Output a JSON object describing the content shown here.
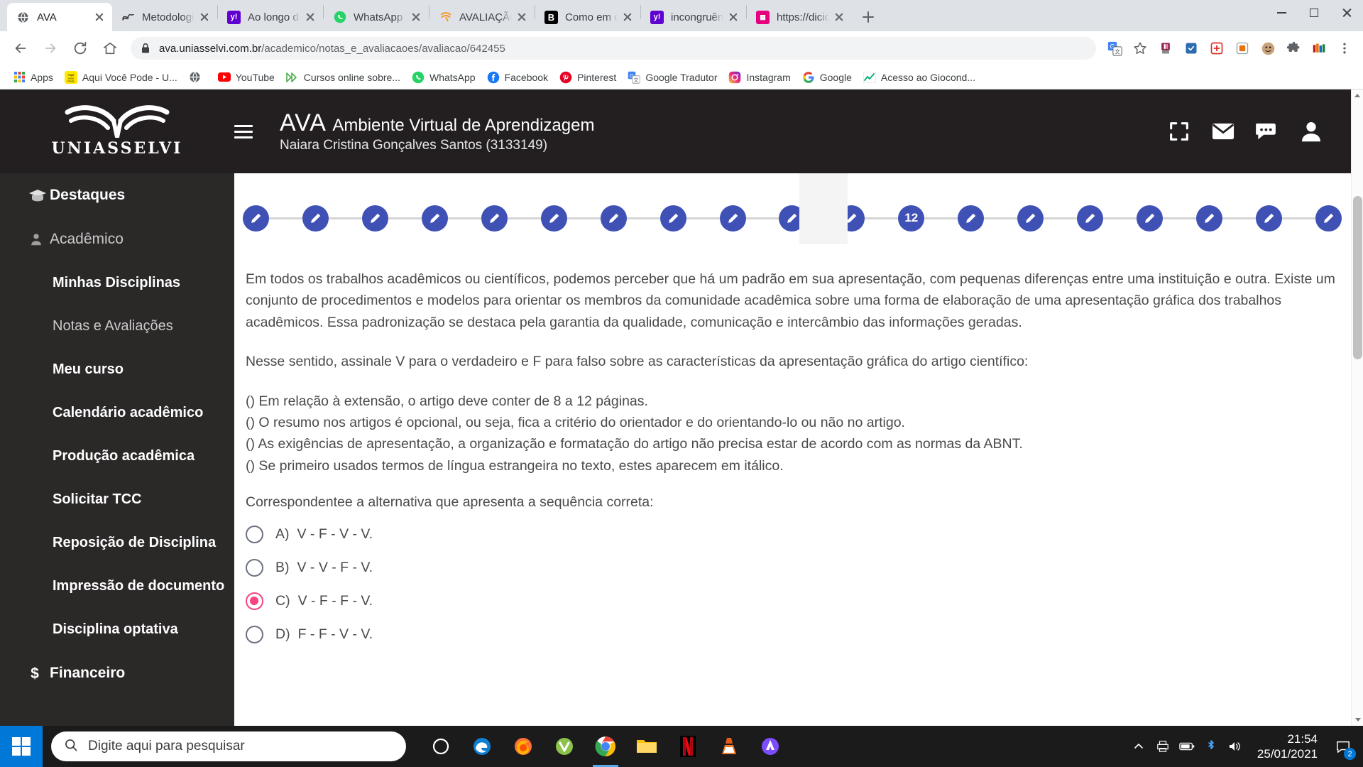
{
  "browser": {
    "tabs": [
      {
        "title": "AVA",
        "favicon": "globe-icon",
        "favicon_color": "#5f6368",
        "active": true
      },
      {
        "title": "Metodologia",
        "favicon": "wave-icon",
        "favicon_color": "#231f20",
        "active": false
      },
      {
        "title": "Ao longo do",
        "favicon": "yahoo-icon",
        "favicon_color": "#6001d2",
        "active": false
      },
      {
        "title": "WhatsApp",
        "favicon": "whatsapp-icon",
        "favicon_color": "#25d366",
        "active": false
      },
      {
        "title": "AVALIAÇÃO",
        "favicon": "uniasselvi-icon",
        "favicon_color": "#f7941d",
        "active": false
      },
      {
        "title": "Como em qu",
        "favicon": "brainly-icon",
        "favicon_color": "#000000",
        "active": false
      },
      {
        "title": "incongruênc",
        "favicon": "yahoo-icon",
        "favicon_color": "#6001d2",
        "active": false
      },
      {
        "title": "https://dicio",
        "favicon": "dicio-icon",
        "favicon_color": "#e6007e",
        "active": false
      }
    ],
    "newtab_label": "Nova guia",
    "window_controls": {
      "minimize": "minimize-button",
      "maximize": "maximize-button",
      "close": "close-button"
    },
    "nav": {
      "back": "Voltar",
      "forward": "Avançar",
      "reload": "Recarregar",
      "home": "Página inicial"
    },
    "omnibox": {
      "secure_icon": "lock-icon",
      "host": "ava.uniasselvi.com.br",
      "path": "/academico/notas_e_avaliacaoes/avaliacao/642455",
      "full_url": "ava.uniasselvi.com.br/academico/notas_e_avaliacaoes/avaliacao/642455"
    },
    "toolbar_extensions": [
      {
        "name": "translate-icon",
        "color": "#4285f4"
      },
      {
        "name": "bookmark-star-icon",
        "color": "#5f6368"
      },
      {
        "name": "extension-pink-icon",
        "color": "#8e2252"
      },
      {
        "name": "extension-blue-icon",
        "color": "#2b6cb0"
      },
      {
        "name": "extension-red-icon",
        "color": "#d93025"
      },
      {
        "name": "extension-orange-icon",
        "color": "#e8710a"
      },
      {
        "name": "extension-avatar-icon",
        "color": "#8d6e63"
      },
      {
        "name": "extensions-puzzle-icon",
        "color": "#5f6368"
      },
      {
        "name": "extension-multicolor-icon",
        "color": "#ba1b1b"
      },
      {
        "name": "chrome-menu-icon",
        "color": "#5f6368"
      }
    ],
    "bookmarks": [
      {
        "label": "Apps",
        "icon": "apps-grid-icon"
      },
      {
        "label": "Aqui Você Pode - U...",
        "icon": "aqui-voce-pode-icon"
      },
      {
        "label": "",
        "icon": "globe-icon"
      },
      {
        "label": "YouTube",
        "icon": "youtube-icon"
      },
      {
        "label": "Cursos online sobre...",
        "icon": "doubleplay-icon"
      },
      {
        "label": "WhatsApp",
        "icon": "whatsapp-icon"
      },
      {
        "label": "Facebook",
        "icon": "facebook-icon"
      },
      {
        "label": "Pinterest",
        "icon": "pinterest-icon"
      },
      {
        "label": "Google Tradutor",
        "icon": "translate-icon"
      },
      {
        "label": "Instagram",
        "icon": "instagram-icon"
      },
      {
        "label": "Google",
        "icon": "google-icon"
      },
      {
        "label": "Acesso ao Giocond...",
        "icon": "chart-green-icon"
      }
    ]
  },
  "ava": {
    "logo_text": "UNIASSELVI",
    "menu_toggle": "menu-toggle",
    "brand_short": "AVA",
    "brand_full": "Ambiente Virtual de Aprendizagem",
    "user": "Naiara Cristina Gonçalves Santos (3133149)",
    "header_icons": [
      {
        "name": "fullscreen-icon"
      },
      {
        "name": "mail-icon"
      },
      {
        "name": "chat-icon"
      },
      {
        "name": "user-icon"
      }
    ],
    "sidebar": [
      {
        "label": "Destaques",
        "icon": "graduation-cap-icon",
        "style": "top"
      },
      {
        "label": "Acadêmico",
        "icon": "user-icon",
        "style": "section"
      },
      {
        "label": "Minhas Disciplinas",
        "icon": "",
        "style": "sub-bold"
      },
      {
        "label": "Notas e Avaliações",
        "icon": "",
        "style": "sub"
      },
      {
        "label": "Meu curso",
        "icon": "",
        "style": "sub-bold"
      },
      {
        "label": "Calendário acadêmico",
        "icon": "",
        "style": "sub-bold"
      },
      {
        "label": "Produção acadêmica",
        "icon": "",
        "style": "sub-bold"
      },
      {
        "label": "Solicitar TCC",
        "icon": "",
        "style": "sub-bold"
      },
      {
        "label": "Reposição de Disciplina",
        "icon": "",
        "style": "sub-bold"
      },
      {
        "label": "Impressão de documento",
        "icon": "",
        "style": "sub-bold"
      },
      {
        "label": "Disciplina optativa",
        "icon": "",
        "style": "sub-bold"
      },
      {
        "label": "Financeiro",
        "icon": "dollar-icon",
        "style": "section-bold"
      }
    ],
    "question_nav": {
      "total": 19,
      "current_index": 12,
      "current_label": "12",
      "dot_icon": "pencil-icon",
      "dot_color": "#3f51b5"
    },
    "question": {
      "paragraph1": "Em todos os trabalhos acadêmicos ou científicos, podemos perceber que há um padrão em sua apresentação, com pequenas diferenças entre uma instituição e outra. Existe um conjunto de procedimentos e modelos para orientar os membros da comunidade acadêmica sobre uma forma de elaboração de uma apresentação gráfica dos trabalhos acadêmicos. Essa padronização se destaca pela garantia da qualidade, comunicação e intercâmbio das informações geradas.",
      "paragraph2": "Nesse sentido, assinale V para o verdadeiro e F para falso sobre as características da apresentação gráfica do artigo científico:",
      "statements": [
        "() Em relação à extensão, o artigo deve conter de 8 a 12 páginas.",
        "() O resumo nos artigos é opcional, ou seja, fica a critério do orientador e do orientando-lo ou não no artigo.",
        "() As exigências de apresentação, a organização e formatação do artigo não precisa estar de acordo com as normas da ABNT.",
        "() Se primeiro usados termos de língua estrangeira no texto, estes aparecem em itálico."
      ],
      "prompt": "Correspondentee a alternativa que apresenta a sequência correta:",
      "options": [
        {
          "letter": "A)",
          "text": "V - F - V - V.",
          "selected": false
        },
        {
          "letter": "B)",
          "text": "V - V - F - V.",
          "selected": false
        },
        {
          "letter": "C)",
          "text": "V - F - F - V.",
          "selected": true
        },
        {
          "letter": "D)",
          "text": "F - F - V - V.",
          "selected": false
        }
      ],
      "selected_color": "#f8457f"
    }
  },
  "taskbar": {
    "start": "start-button",
    "search_placeholder": "Digite aqui para pesquisar",
    "search_icon": "search-icon",
    "items": [
      {
        "name": "cortana-icon",
        "open": false
      },
      {
        "name": "edge-icon",
        "open": false
      },
      {
        "name": "firefox-icon",
        "open": false
      },
      {
        "name": "vivaldi-icon",
        "open": false
      },
      {
        "name": "chrome-icon",
        "open": true
      },
      {
        "name": "file-explorer-icon",
        "open": false
      },
      {
        "name": "netflix-icon",
        "open": false
      },
      {
        "name": "vlc-icon",
        "open": false
      },
      {
        "name": "avast-icon",
        "open": false
      }
    ],
    "tray": [
      {
        "name": "show-hidden-icons-chevron"
      },
      {
        "name": "printer-icon"
      },
      {
        "name": "battery-icon"
      },
      {
        "name": "bluetooth-icon"
      },
      {
        "name": "volume-icon"
      }
    ],
    "time": "21:54",
    "date": "25/01/2021",
    "notification_count": "2"
  }
}
